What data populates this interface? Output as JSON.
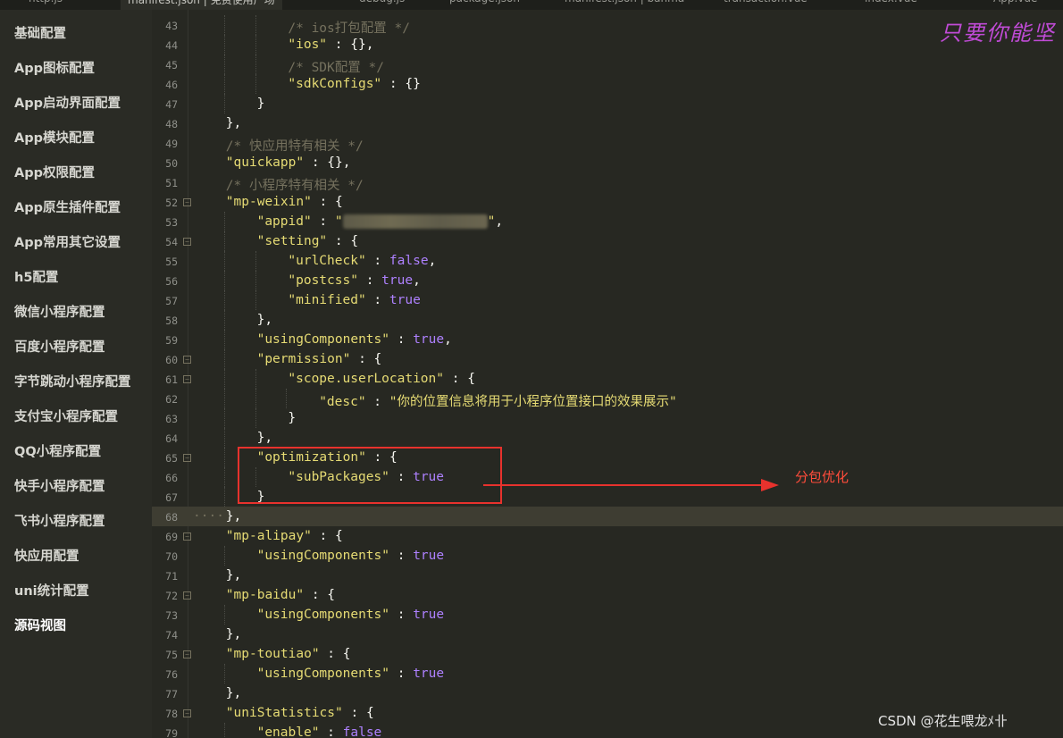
{
  "tabs": [
    {
      "label": "http.js",
      "active": false
    },
    {
      "label": "manifest.json | 免费使用广场",
      "active": true
    },
    {
      "label": "debug.js",
      "active": false
    },
    {
      "label": "package.json",
      "active": false
    },
    {
      "label": "manifest.json | banma",
      "active": false
    },
    {
      "label": "transaction.vue",
      "active": false
    },
    {
      "label": "index.vue",
      "active": false
    },
    {
      "label": "App.vue",
      "active": false
    }
  ],
  "sidebar": {
    "items": [
      {
        "label": "基础配置"
      },
      {
        "label": "App图标配置"
      },
      {
        "label": "App启动界面配置"
      },
      {
        "label": "App模块配置"
      },
      {
        "label": "App权限配置"
      },
      {
        "label": "App原生插件配置"
      },
      {
        "label": "App常用其它设置"
      },
      {
        "label": "h5配置"
      },
      {
        "label": "微信小程序配置"
      },
      {
        "label": "百度小程序配置"
      },
      {
        "label": "字节跳动小程序配置"
      },
      {
        "label": "支付宝小程序配置"
      },
      {
        "label": "QQ小程序配置"
      },
      {
        "label": "快手小程序配置"
      },
      {
        "label": "飞书小程序配置"
      },
      {
        "label": "快应用配置"
      },
      {
        "label": "uni统计配置"
      },
      {
        "label": "源码视图"
      }
    ],
    "active_index": 17
  },
  "editor": {
    "current_line": 68,
    "lines": [
      {
        "n": "43",
        "indent": 3,
        "fold": false,
        "parts": [
          [
            "c-com",
            "/* ios打包配置 */"
          ]
        ]
      },
      {
        "n": "44",
        "indent": 3,
        "fold": false,
        "parts": [
          [
            "c-str",
            "\"ios\""
          ],
          [
            "",
            " : {},"
          ]
        ]
      },
      {
        "n": "45",
        "indent": 3,
        "fold": false,
        "parts": [
          [
            "c-com",
            "/* SDK配置 */"
          ]
        ]
      },
      {
        "n": "46",
        "indent": 3,
        "fold": false,
        "parts": [
          [
            "c-str",
            "\"sdkConfigs\""
          ],
          [
            "",
            " : {}"
          ]
        ]
      },
      {
        "n": "47",
        "indent": 2,
        "fold": false,
        "parts": [
          [
            "",
            "}"
          ]
        ]
      },
      {
        "n": "48",
        "indent": 1,
        "fold": false,
        "parts": [
          [
            "",
            "},"
          ]
        ]
      },
      {
        "n": "49",
        "indent": 1,
        "fold": false,
        "parts": [
          [
            "c-com",
            "/* 快应用特有相关 */"
          ]
        ]
      },
      {
        "n": "50",
        "indent": 1,
        "fold": false,
        "parts": [
          [
            "c-str",
            "\"quickapp\""
          ],
          [
            "",
            " : {},"
          ]
        ]
      },
      {
        "n": "51",
        "indent": 1,
        "fold": false,
        "parts": [
          [
            "c-com",
            "/* 小程序特有相关 */"
          ]
        ]
      },
      {
        "n": "52",
        "indent": 1,
        "fold": true,
        "parts": [
          [
            "c-str",
            "\"mp-weixin\""
          ],
          [
            "",
            " : {"
          ]
        ]
      },
      {
        "n": "53",
        "indent": 2,
        "fold": false,
        "blur": true,
        "parts": [
          [
            "c-str",
            "\"appid\""
          ],
          [
            "",
            " : "
          ],
          [
            "c-str",
            "\""
          ],
          [
            "BLUR",
            ""
          ],
          [
            "c-str",
            "\""
          ],
          [
            "",
            ","
          ]
        ]
      },
      {
        "n": "54",
        "indent": 2,
        "fold": true,
        "parts": [
          [
            "c-str",
            "\"setting\""
          ],
          [
            "",
            " : {"
          ]
        ]
      },
      {
        "n": "55",
        "indent": 3,
        "fold": false,
        "parts": [
          [
            "c-str",
            "\"urlCheck\""
          ],
          [
            "",
            " : "
          ],
          [
            "c-kw",
            "false"
          ],
          [
            "",
            ","
          ]
        ]
      },
      {
        "n": "56",
        "indent": 3,
        "fold": false,
        "parts": [
          [
            "c-str",
            "\"postcss\""
          ],
          [
            "",
            " : "
          ],
          [
            "c-kw",
            "true"
          ],
          [
            "",
            ","
          ]
        ]
      },
      {
        "n": "57",
        "indent": 3,
        "fold": false,
        "parts": [
          [
            "c-str",
            "\"minified\""
          ],
          [
            "",
            " : "
          ],
          [
            "c-kw",
            "true"
          ]
        ]
      },
      {
        "n": "58",
        "indent": 2,
        "fold": false,
        "parts": [
          [
            "",
            "},"
          ]
        ]
      },
      {
        "n": "59",
        "indent": 2,
        "fold": false,
        "parts": [
          [
            "c-str",
            "\"usingComponents\""
          ],
          [
            "",
            " : "
          ],
          [
            "c-kw",
            "true"
          ],
          [
            "",
            ","
          ]
        ]
      },
      {
        "n": "60",
        "indent": 2,
        "fold": true,
        "parts": [
          [
            "c-str",
            "\"permission\""
          ],
          [
            "",
            " : {"
          ]
        ]
      },
      {
        "n": "61",
        "indent": 3,
        "fold": true,
        "parts": [
          [
            "c-str",
            "\"scope.userLocation\""
          ],
          [
            "",
            " : {"
          ]
        ]
      },
      {
        "n": "62",
        "indent": 4,
        "fold": false,
        "parts": [
          [
            "c-str",
            "\"desc\""
          ],
          [
            "",
            " : "
          ],
          [
            "c-str",
            "\"你的位置信息将用于小程序位置接口的效果展示\""
          ]
        ]
      },
      {
        "n": "63",
        "indent": 3,
        "fold": false,
        "parts": [
          [
            "",
            "}"
          ]
        ]
      },
      {
        "n": "64",
        "indent": 2,
        "fold": false,
        "parts": [
          [
            "",
            "},"
          ]
        ]
      },
      {
        "n": "65",
        "indent": 2,
        "fold": true,
        "parts": [
          [
            "c-str",
            "\"optimization\""
          ],
          [
            "",
            " : {"
          ]
        ]
      },
      {
        "n": "66",
        "indent": 3,
        "fold": false,
        "parts": [
          [
            "c-str",
            "\"subPackages\""
          ],
          [
            "",
            " : "
          ],
          [
            "c-kw",
            "true"
          ]
        ]
      },
      {
        "n": "67",
        "indent": 2,
        "fold": false,
        "parts": [
          [
            "",
            "}"
          ]
        ]
      },
      {
        "n": "68",
        "indent": 1,
        "fold": false,
        "dots": true,
        "parts": [
          [
            "",
            "},"
          ]
        ]
      },
      {
        "n": "69",
        "indent": 1,
        "fold": true,
        "parts": [
          [
            "c-str",
            "\"mp-alipay\""
          ],
          [
            "",
            " : {"
          ]
        ]
      },
      {
        "n": "70",
        "indent": 2,
        "fold": false,
        "parts": [
          [
            "c-str",
            "\"usingComponents\""
          ],
          [
            "",
            " : "
          ],
          [
            "c-kw",
            "true"
          ]
        ]
      },
      {
        "n": "71",
        "indent": 1,
        "fold": false,
        "parts": [
          [
            "",
            "},"
          ]
        ]
      },
      {
        "n": "72",
        "indent": 1,
        "fold": true,
        "parts": [
          [
            "c-str",
            "\"mp-baidu\""
          ],
          [
            "",
            " : {"
          ]
        ]
      },
      {
        "n": "73",
        "indent": 2,
        "fold": false,
        "parts": [
          [
            "c-str",
            "\"usingComponents\""
          ],
          [
            "",
            " : "
          ],
          [
            "c-kw",
            "true"
          ]
        ]
      },
      {
        "n": "74",
        "indent": 1,
        "fold": false,
        "parts": [
          [
            "",
            "},"
          ]
        ]
      },
      {
        "n": "75",
        "indent": 1,
        "fold": true,
        "parts": [
          [
            "c-str",
            "\"mp-toutiao\""
          ],
          [
            "",
            " : {"
          ]
        ]
      },
      {
        "n": "76",
        "indent": 2,
        "fold": false,
        "parts": [
          [
            "c-str",
            "\"usingComponents\""
          ],
          [
            "",
            " : "
          ],
          [
            "c-kw",
            "true"
          ]
        ]
      },
      {
        "n": "77",
        "indent": 1,
        "fold": false,
        "parts": [
          [
            "",
            "},"
          ]
        ]
      },
      {
        "n": "78",
        "indent": 1,
        "fold": true,
        "parts": [
          [
            "c-str",
            "\"uniStatistics\""
          ],
          [
            "",
            " : {"
          ]
        ]
      },
      {
        "n": "79",
        "indent": 2,
        "fold": false,
        "parts": [
          [
            "c-str",
            "\"enable\""
          ],
          [
            "",
            " : "
          ],
          [
            "c-kw",
            "false"
          ]
        ]
      }
    ]
  },
  "annotation": {
    "label": "分包优化",
    "color": "#e8322d"
  },
  "handwritten_text": "只要你能坚",
  "watermark": "CSDN @花生喂龙ﾒ卝",
  "colors": {
    "background": "#272822",
    "string": "#e6db74",
    "keyword": "#ae81ff",
    "comment": "#75715e",
    "sidebar": "#2a2b25"
  }
}
